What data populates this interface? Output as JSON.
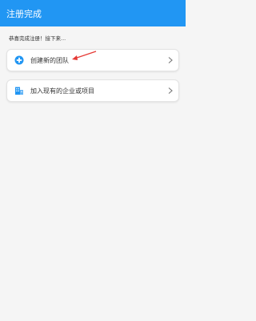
{
  "header": {
    "title": "注册完成"
  },
  "message": "恭喜完成注册！接下来...",
  "options": [
    {
      "label": "创建新的团队",
      "icon": "plus-circle-icon"
    },
    {
      "label": "加入现有的企业或项目",
      "icon": "building-icon"
    }
  ],
  "colors": {
    "accent": "#2196f3",
    "arrow": "#e53935"
  }
}
